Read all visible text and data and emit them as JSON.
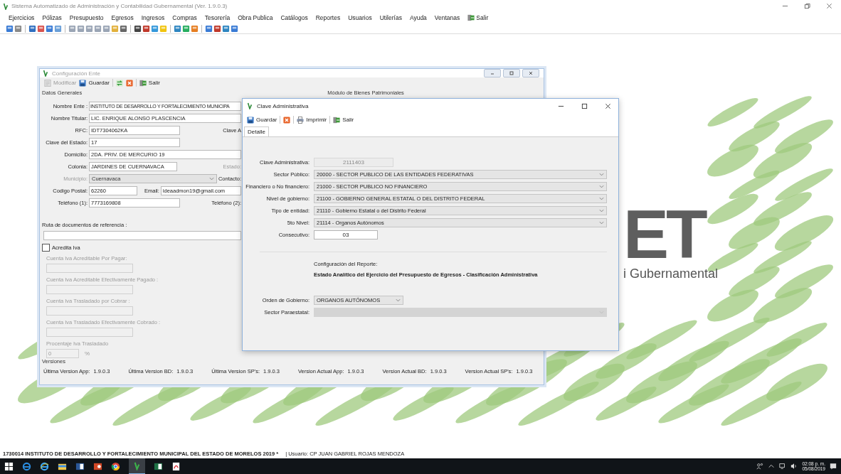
{
  "app": {
    "title": "Sistema Automatizado de Administración y Contabilidad Gubernamental  (Ver. 1.9.0.3)",
    "menu": [
      {
        "label": "Ejercicios",
        "kind": "text"
      },
      {
        "label": "Pólizas",
        "kind": "text"
      },
      {
        "label": "Presupuesto",
        "kind": "text"
      },
      {
        "label": "Egresos",
        "kind": "text"
      },
      {
        "label": "Ingresos",
        "kind": "text"
      },
      {
        "label": "Compras",
        "kind": "text"
      },
      {
        "label": "Tesorería",
        "kind": "text"
      },
      {
        "label": "Obra Publica",
        "kind": "text"
      },
      {
        "label": "Catálogos",
        "kind": "text"
      },
      {
        "label": "Reportes",
        "kind": "text"
      },
      {
        "label": "Usuarios",
        "kind": "text"
      },
      {
        "label": "Utilerías",
        "kind": "text"
      },
      {
        "label": "Ayuda",
        "kind": "text"
      },
      {
        "label": "Ventanas",
        "kind": "text"
      },
      {
        "label": "Salir",
        "kind": "exit"
      }
    ]
  },
  "background_logo": {
    "mark": "ET",
    "tagline": "i Gubernamental"
  },
  "config_window": {
    "title": "Configuración Ente",
    "toolbar": [
      {
        "label": "Modificar",
        "kind": "edit",
        "disabled": true
      },
      {
        "label": "Guardar",
        "kind": "save",
        "disabled": false
      },
      {
        "kind": "refresh",
        "disabled": false
      },
      {
        "kind": "cancel",
        "disabled": false
      },
      {
        "label": "Salir",
        "kind": "exit",
        "disabled": false
      }
    ],
    "section_title": "Datos Generales",
    "right_section_title": "Módulo de Bienes Patrimoniales",
    "rows": [
      {
        "label": "Nombre Ente :",
        "value": "INSTITUTO DE DESARROLLO Y FORTALECIMIENTO MUNICIPA",
        "kind": "field",
        "disabled": false
      },
      {
        "label": "Nombre Titular:",
        "value": "LIC. ENRIQUE ALONSO PLASCENCIA",
        "kind": "field",
        "disabled": false
      },
      {
        "label": "RFC:",
        "value": "IDT7304062KA",
        "kind": "field",
        "disabled": false,
        "aside": {
          "text": "Clave A",
          "disabled": false
        }
      },
      {
        "label": "Clave del Estado:",
        "value": "17",
        "kind": "field",
        "disabled": false
      },
      {
        "label": "Domicilio:",
        "value": "2DA. PRIV. DE MERCURIO 19",
        "kind": "field",
        "disabled": false
      },
      {
        "label": "Colonia:",
        "value": "JARDINES DE CUERNAVACA",
        "kind": "field",
        "disabled": false,
        "aside": {
          "text": "Estado:",
          "disabled": true
        }
      },
      {
        "label": "Municipio:",
        "value": "Cuernavaca",
        "kind": "select",
        "disabled": true,
        "aside": {
          "text": "Contacto:",
          "disabled": false
        }
      },
      {
        "label": "Codigo Postal:",
        "value": "62260",
        "kind": "field",
        "disabled": false,
        "aside": {
          "text": "Email:",
          "disabled": false,
          "value": "ideaadmon19@gmail.com"
        }
      },
      {
        "label": "Teléfono (1):",
        "value": "7773169808",
        "kind": "field",
        "disabled": false,
        "aside": {
          "text": "Teléfono (2):",
          "disabled": false
        }
      }
    ],
    "documents": {
      "label": "Ruta de documentos de referencia :"
    },
    "iva": {
      "label": "Acredita Iva",
      "checked": false,
      "accounts": [
        {
          "label": "Cuenta Iva Acreditable Por Pagar:"
        },
        {
          "label": "Cuenta Iva Acreditable Efectivamente Pagado :"
        },
        {
          "label": "Cuenta Iva Trasladado por Cobrar :"
        },
        {
          "label": "Cuenta Iva Trasladado Efectivamente Cobrado :"
        }
      ],
      "percent": {
        "label": "Procentaje Iva Trasladado",
        "value": "0",
        "unit": "%"
      }
    },
    "versions": {
      "title": "Versiones",
      "items": [
        {
          "label": "Última Version App:",
          "value": "1.9.0.3"
        },
        {
          "label": "Última Version BD:",
          "value": "1.9.0.3"
        },
        {
          "label": "Última Version SP's:",
          "value": "1.9.0.3"
        },
        {
          "label": "Version Actual App:",
          "value": "1.9.0.3"
        },
        {
          "label": "Version Actual BD:",
          "value": "1.9.0.3"
        },
        {
          "label": "Version Actual SP's:",
          "value": "1.9.0.3"
        }
      ]
    }
  },
  "dialog": {
    "title": "Clave Administrativa",
    "toolbar": [
      {
        "label": "Guardar",
        "kind": "save"
      },
      {
        "kind": "cancel"
      },
      {
        "label": "Imprimir",
        "kind": "print"
      },
      {
        "label": "Salir",
        "kind": "exit"
      }
    ],
    "tabs": [
      {
        "label": "Detalle",
        "selected": true
      }
    ],
    "fields": [
      {
        "label": "Clave Administrativa:",
        "value": "2111403",
        "kind": "readonly"
      },
      {
        "label": "Sector Público:",
        "value": "20000 - SECTOR PUBLICO DE LAS ENTIDADES FEDERATIVAS",
        "kind": "select"
      },
      {
        "label": "Financiero o No financiero:",
        "value": "21000 - SECTOR PUBLICO NO FINANCIERO",
        "kind": "select"
      },
      {
        "label": "Nivel de gobierno:",
        "value": "21100 - GOBIERNO GENERAL ESTATAL O DEL DISTRITO FEDERAL",
        "kind": "select"
      },
      {
        "label": "Tipo de entidad:",
        "value": "21110 - Gobierno Estatal o del Distrito Federal",
        "kind": "select"
      },
      {
        "label": "5to Nivel:",
        "value": "21114 - Organos Autónomos",
        "kind": "select"
      },
      {
        "label": "Consecutivo:",
        "value": "03",
        "kind": "text"
      }
    ],
    "report": {
      "heading": "Configuración del Reporte:",
      "name": "Estado Analítico del Ejercicio del Presupuesto de Egresos - Clasificación Administrativa"
    },
    "options": [
      {
        "label": "Orden de Gobierno:",
        "value": "ORGANOS AUTÓNOMOS",
        "disabled": false
      },
      {
        "label": "Sector Paraestatal:",
        "disabled": true
      }
    ]
  },
  "status_bar": {
    "entity": "1730014 INSTITUTO DE DESARROLLO Y FORTALECIMIENTO MUNICIPAL DEL ESTADO DE MORELOS  2019  *",
    "user": "| Usuario: CP JUAN GABRIEL ROJAS MENDOZA"
  },
  "clock": {
    "time": "02:08 p. m.",
    "date": "05/08/2019"
  }
}
